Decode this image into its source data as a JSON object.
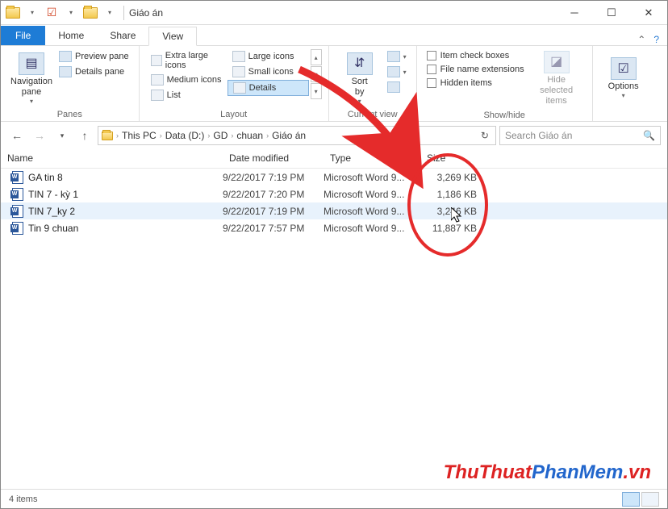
{
  "window": {
    "title": "Giáo án"
  },
  "tabs": {
    "file": "File",
    "home": "Home",
    "share": "Share",
    "view": "View"
  },
  "ribbon": {
    "panes": {
      "nav": "Navigation\npane",
      "preview": "Preview pane",
      "details": "Details pane",
      "label": "Panes"
    },
    "layout": {
      "xl": "Extra large icons",
      "large": "Large icons",
      "medium": "Medium icons",
      "small": "Small icons",
      "list": "List",
      "details": "Details",
      "label": "Layout"
    },
    "curview": {
      "sort": "Sort\nby",
      "label": "Current view"
    },
    "showhide": {
      "chk1": "Item check boxes",
      "chk2": "File name extensions",
      "chk3": "Hidden items",
      "hide": "Hide selected\nitems",
      "label": "Show/hide"
    },
    "options": "Options"
  },
  "breadcrumb": [
    "This PC",
    "Data (D:)",
    "GD",
    "chuan",
    "Giáo án"
  ],
  "search_placeholder": "Search Giáo án",
  "columns": {
    "name": "Name",
    "date": "Date modified",
    "type": "Type",
    "size": "Size"
  },
  "files": [
    {
      "name": "GA tin 8",
      "date": "9/22/2017 7:19 PM",
      "type": "Microsoft Word 9...",
      "size": "3,269 KB"
    },
    {
      "name": "TIN 7 - kỳ 1",
      "date": "9/22/2017 7:20 PM",
      "type": "Microsoft Word 9...",
      "size": "1,186 KB"
    },
    {
      "name": "TIN 7_ky 2",
      "date": "9/22/2017 7:19 PM",
      "type": "Microsoft Word 9...",
      "size": "3,246 KB"
    },
    {
      "name": "Tin 9 chuan",
      "date": "9/22/2017 7:57 PM",
      "type": "Microsoft Word 9...",
      "size": "11,887 KB"
    }
  ],
  "status": "4 items",
  "watermark": {
    "a": "ThuThuat",
    "b": "PhanMem",
    "c": ".vn"
  }
}
